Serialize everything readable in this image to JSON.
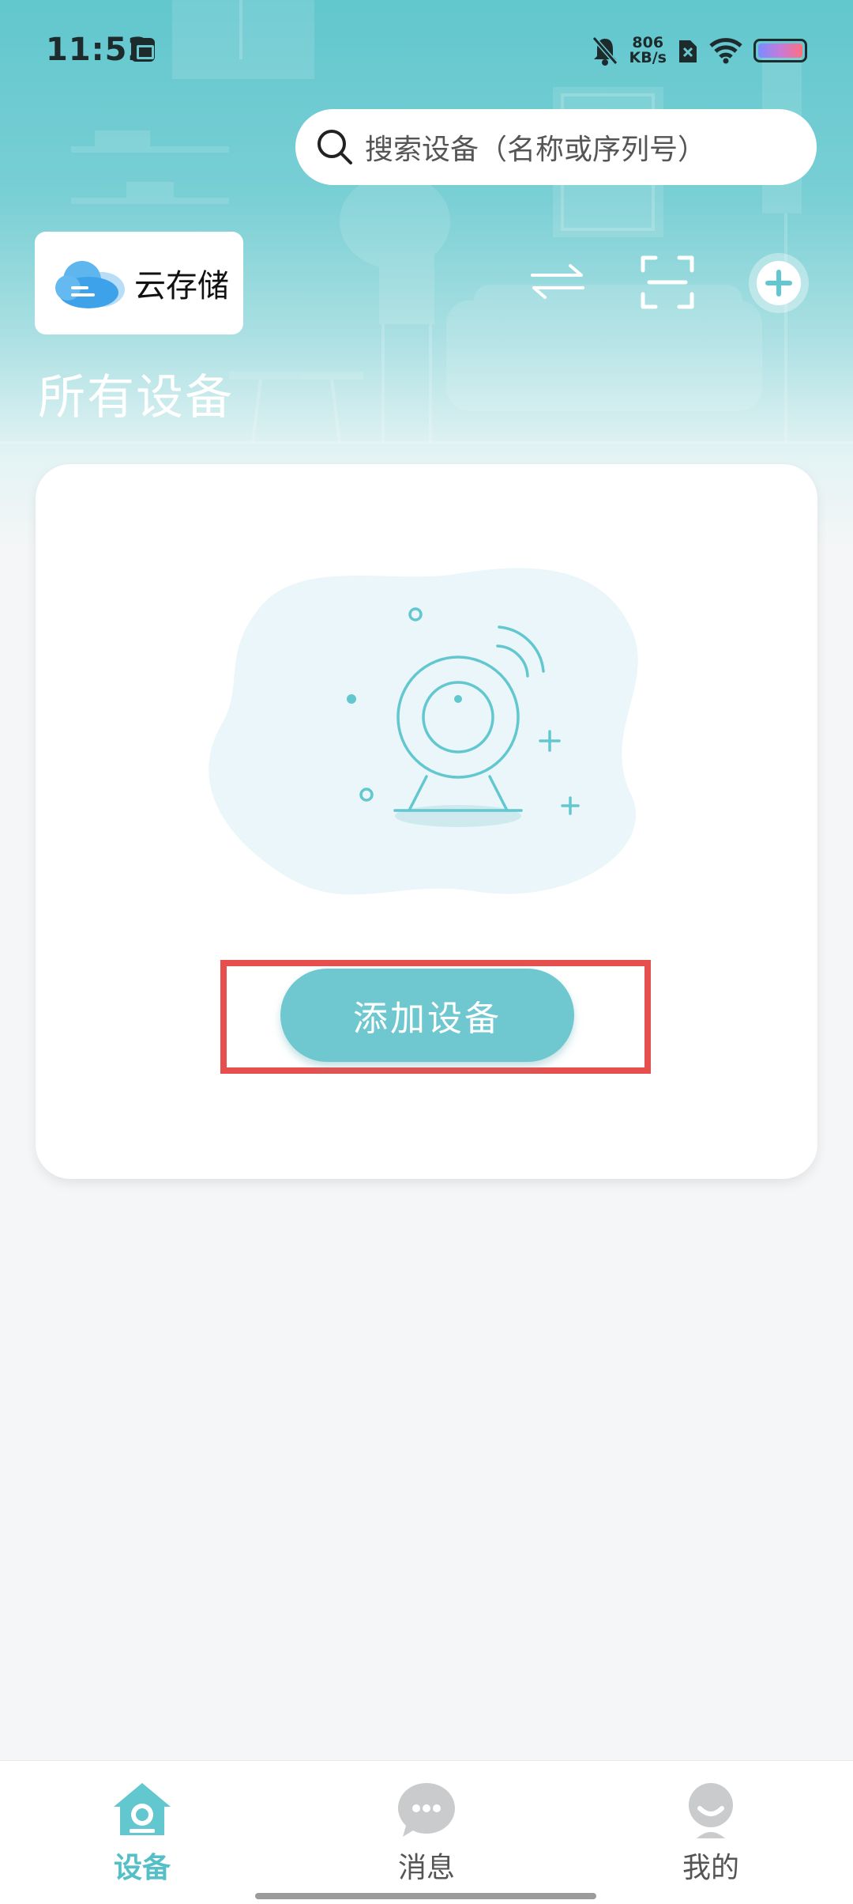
{
  "status_bar": {
    "time": "11:52",
    "net_speed_value": "806",
    "net_speed_unit": "KB/s"
  },
  "search": {
    "placeholder": "搜索设备（名称或序列号）"
  },
  "cloud_storage": {
    "label": "云存储"
  },
  "section": {
    "title": "所有设备"
  },
  "empty_state": {
    "add_button_label": "添加设备"
  },
  "bottom_nav": {
    "items": [
      {
        "label": "设备",
        "icon": "home-camera-icon",
        "active": true
      },
      {
        "label": "消息",
        "icon": "chat-bubble-icon",
        "active": false
      },
      {
        "label": "我的",
        "icon": "profile-icon",
        "active": false
      }
    ]
  },
  "colors": {
    "accent": "#6fc8cf",
    "header_gradient_top": "#62c7ce",
    "highlight": "#e5504f",
    "background": "#f5f6f7"
  }
}
